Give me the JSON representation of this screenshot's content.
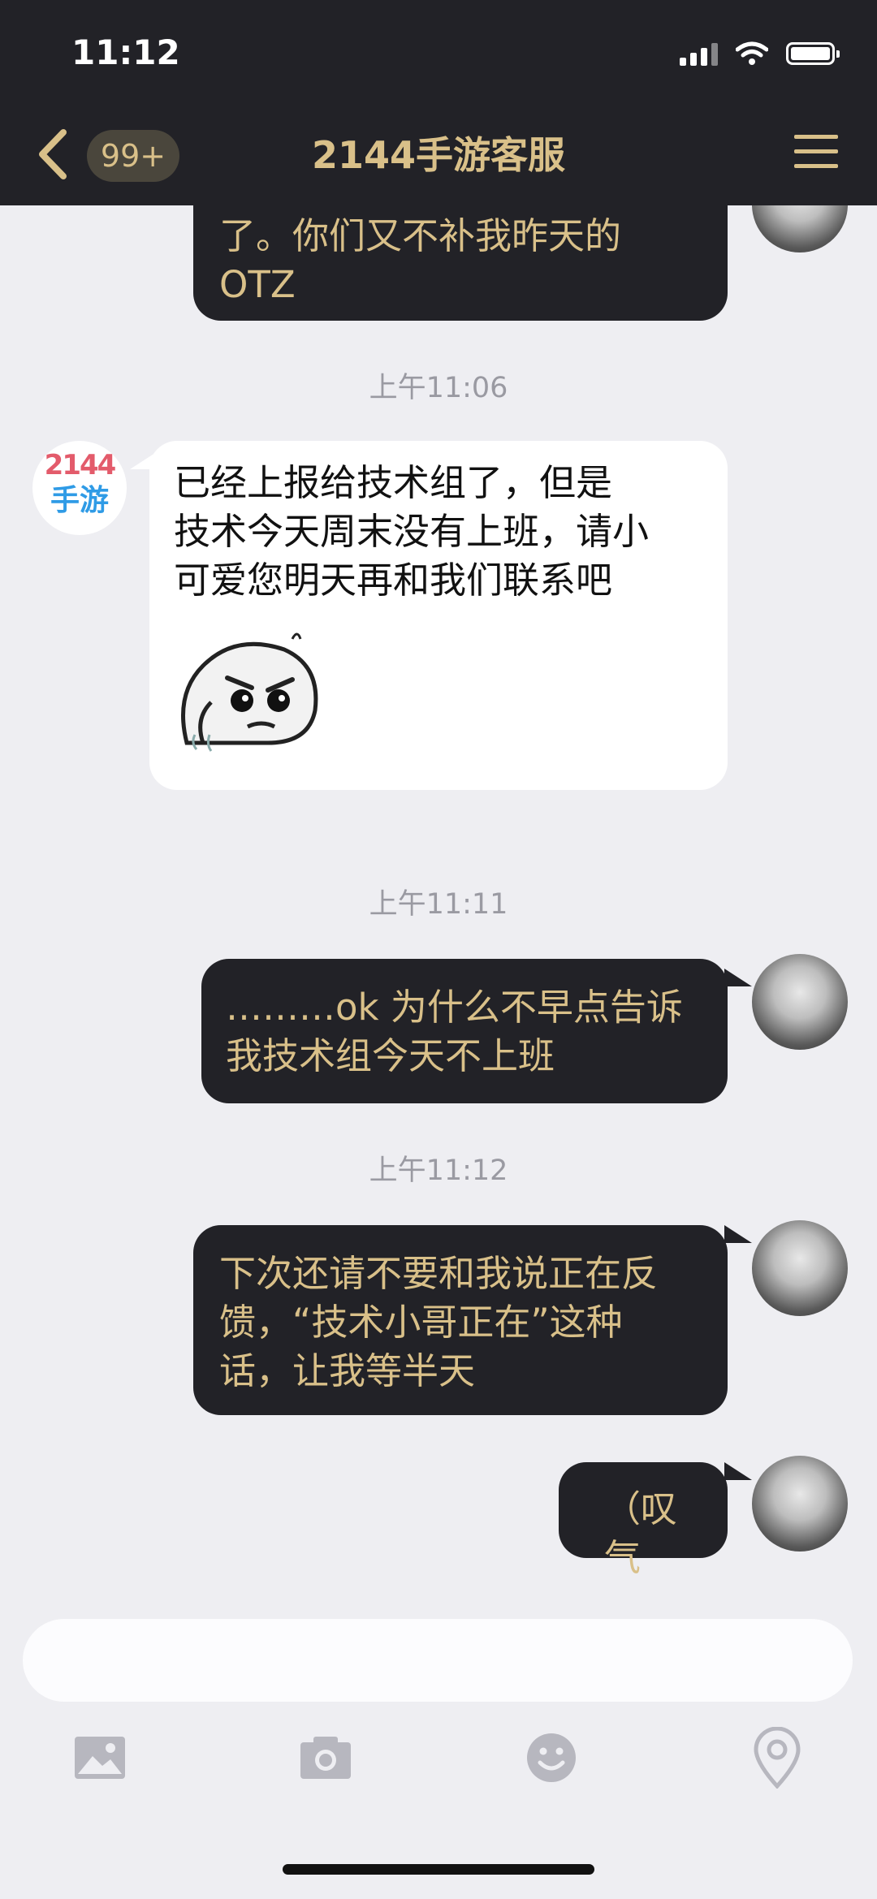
{
  "status_bar": {
    "time": "11:12"
  },
  "header": {
    "unread_badge": "99+",
    "title": "2144手游客服"
  },
  "brand_logo": {
    "line1": "2144",
    "line2": "手游"
  },
  "messages": {
    "m0": {
      "line1": "了。你们又不补我昨天的",
      "line2": "OTZ"
    },
    "t1": "上午11:06",
    "m1": {
      "line1": " 已经上报给技术组了，但是",
      "line2": "技术今天周末没有上班，请小",
      "line3": "可爱您明天再和我们联系吧"
    },
    "t2": "上午11:11",
    "m2": {
      "line1": "………ok 为什么不早点告诉",
      "line2": "我技术组今天不上班"
    },
    "t3": "上午11:12",
    "m3": {
      "line1": "下次还请不要和我说正在反",
      "line2": "馈，“技术小哥正在”这种",
      "line3": "话，让我等半天"
    },
    "m4": {
      "line1": "（叹气"
    }
  },
  "toolbar": [
    "image-icon",
    "camera-icon",
    "emoji-icon",
    "location-icon"
  ],
  "colors": {
    "header_bg": "#222227",
    "accent_gold": "#d9c089",
    "chat_bg": "#eeeef2"
  }
}
